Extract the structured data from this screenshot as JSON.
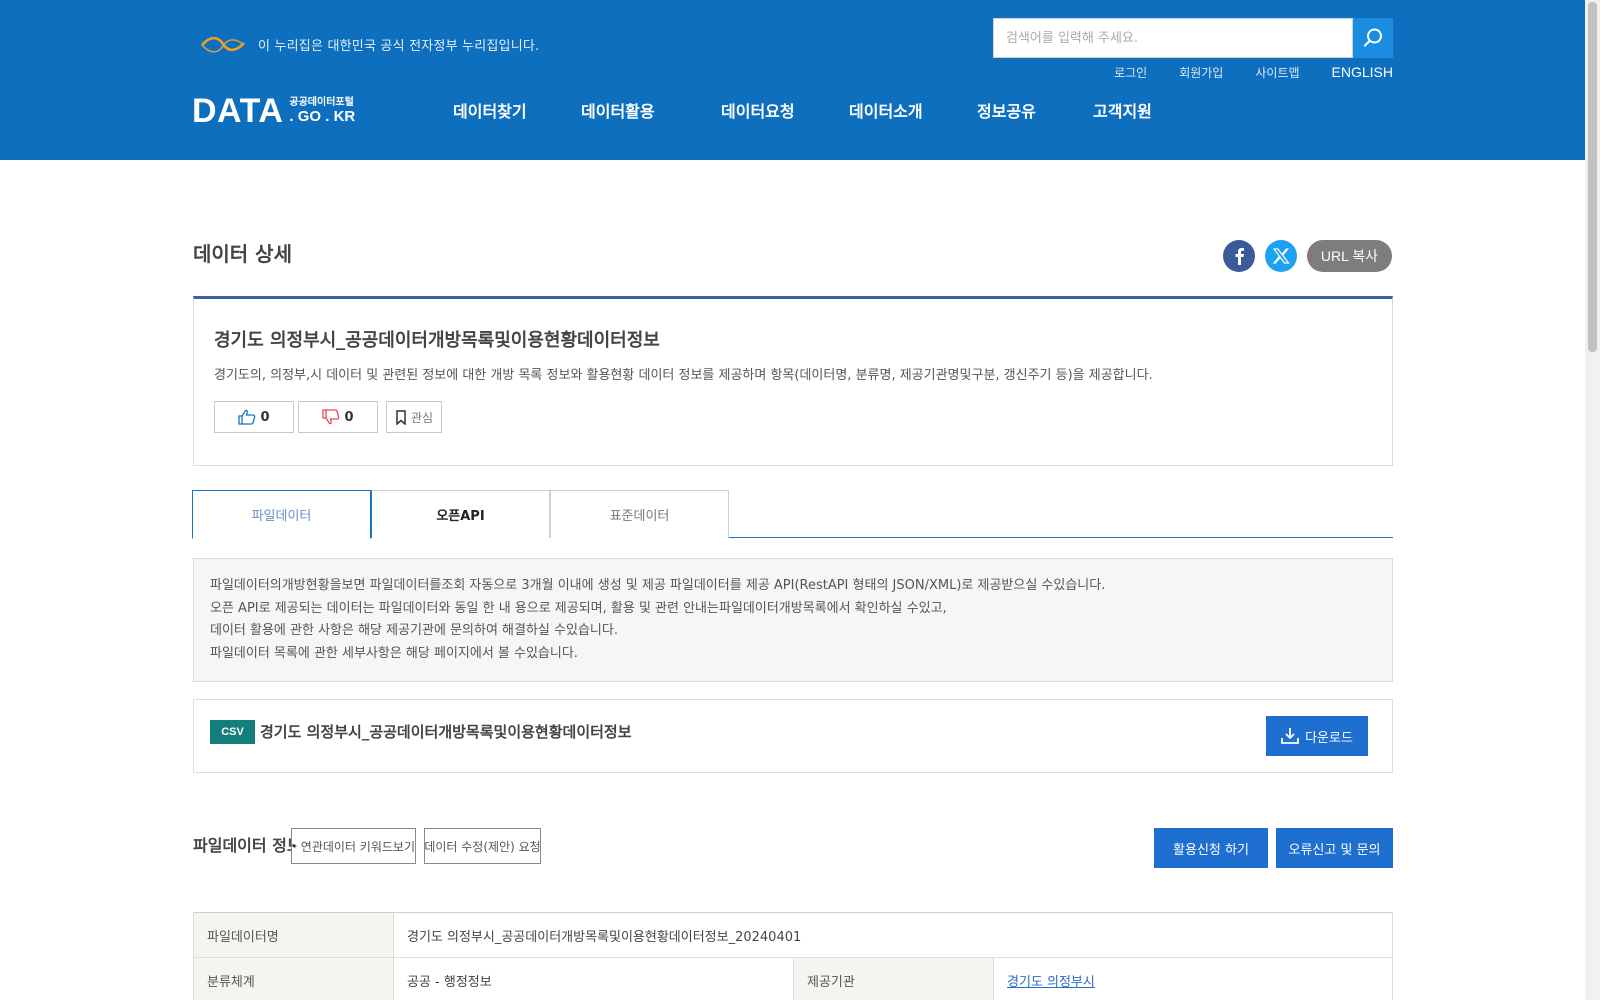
{
  "header": {
    "notice": "이 누리집은 대한민국 공식 전자정부 누리집입니다.",
    "search_placeholder": "검색어를 입력해 주세요.",
    "util_links": [
      "로그인",
      "회원가입",
      "사이트맵",
      "ENGLISH"
    ],
    "logo_main": "DATA",
    "logo_kor": "공공데이터포털",
    "logo_domain": ". GO . KR",
    "nav": [
      "데이터찾기",
      "데이터활용",
      "데이터요청",
      "데이터소개",
      "정보공유",
      "고객지원"
    ]
  },
  "page": {
    "title": "데이터 상세",
    "share_url_label": "URL 복사"
  },
  "dataset": {
    "title": "경기도 의정부시_공공데이터개방목록및이용현황데이터정보",
    "description": "경기도의, 의정부,시 데이터 및 관련된 정보에 대한 개방 목록 정보와 활용현황 데이터 정보를 제공하며 항목(데이터명, 분류명, 제공기관명및구분, 갱신주기 등)을 제공합니다.",
    "likes": "0",
    "dislikes": "0",
    "bookmark_label": "관심"
  },
  "tabs": [
    "파일데이터",
    "오픈API",
    "표준데이터"
  ],
  "info_lines": [
    "파일데이터의개방현황을보면 파일데이터를조회 자동으로 3개월 이내에 생성 및 제공 파일데이터를 제공 API(RestAPI 형태의 JSON/XML)로 제공받으실 수있습니다.",
    "오픈 API로 제공되는 데이터는 파일데이터와 동일 한 내 용으로 제공되며, 활용 및 관련 안내는파일데이터개방목록에서 확인하실 수있고,",
    "데이터 활용에 관한 사항은 해당 제공기관에 문의하여 해결하실 수있습니다.",
    "파일데이터 목록에 관한 세부사항은 해당 페이지에서 볼 수있습니다."
  ],
  "file": {
    "type": "CSV",
    "name": "경기도 의정부시_공공데이터개방목록및이용현황데이터정보",
    "download_label": "다운로드"
  },
  "detail": {
    "label": "파일데이터 정보",
    "tag_button": "연관데이터 키워드보기",
    "request_button": "데이터 수정(제안) 요청",
    "btn_apply": "활용신청 하기",
    "btn_error": "오류신고 및 문의",
    "rows": [
      {
        "th": "파일데이터명",
        "td": "경기도 의정부시_공공데이터개방목록및이용현황데이터정보_20240401"
      },
      {
        "th": "분류체계",
        "td": "공공 - 행정정보",
        "th2": "제공기관",
        "td2": "경기도 의정부시"
      }
    ]
  },
  "colors": {
    "header_bg": "#0e6fbf",
    "accent_blue": "#1f6fd0",
    "csv_badge": "#137e7c"
  }
}
